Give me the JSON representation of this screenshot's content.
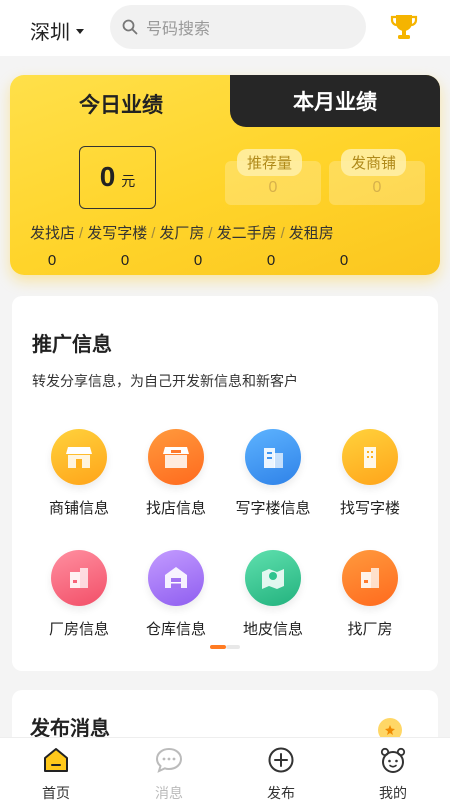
{
  "header": {
    "city": "深圳",
    "search_placeholder": "号码搜索"
  },
  "performance": {
    "tabs": {
      "today": "今日业绩",
      "month": "本月业绩"
    },
    "amount": {
      "value": "0",
      "unit": "元"
    },
    "metrics": [
      {
        "label": "推荐量",
        "value": "0"
      },
      {
        "label": "发商铺",
        "value": "0"
      }
    ],
    "stats": [
      {
        "label": "发找店",
        "value": "0"
      },
      {
        "label": "发写字楼",
        "value": "0"
      },
      {
        "label": "发厂房",
        "value": "0"
      },
      {
        "label": "发二手房",
        "value": "0"
      },
      {
        "label": "发租房",
        "value": "0"
      }
    ],
    "separator": "/"
  },
  "promotion": {
    "title": "推广信息",
    "subtitle": "转发分享信息，为自己开发新信息和新客户",
    "items": [
      {
        "label": "商铺信息",
        "icon": "shop-icon",
        "color": "#ffb21f"
      },
      {
        "label": "找店信息",
        "icon": "find-shop-icon",
        "color": "#ff7a2e"
      },
      {
        "label": "写字楼信息",
        "icon": "office-building-icon",
        "color": "#3d95f2"
      },
      {
        "label": "找写字楼",
        "icon": "find-office-icon",
        "color": "#ffb21f"
      },
      {
        "label": "厂房信息",
        "icon": "factory-icon",
        "color": "#f7647a"
      },
      {
        "label": "仓库信息",
        "icon": "warehouse-icon",
        "color": "#a274f2"
      },
      {
        "label": "地皮信息",
        "icon": "land-map-icon",
        "color": "#2fc48f"
      },
      {
        "label": "找厂房",
        "icon": "find-factory-icon",
        "color": "#ff7a2e"
      }
    ],
    "page_indicator": {
      "current": 1,
      "total": 2
    }
  },
  "publish": {
    "title": "发布消息"
  },
  "nav": {
    "items": [
      {
        "label": "首页",
        "icon": "home-icon",
        "active": true
      },
      {
        "label": "消息",
        "icon": "message-icon",
        "active": false
      },
      {
        "label": "发布",
        "icon": "add-circle-icon",
        "active": false
      },
      {
        "label": "我的",
        "icon": "profile-icon",
        "active": false
      }
    ],
    "active_color": "#ffc81a"
  }
}
